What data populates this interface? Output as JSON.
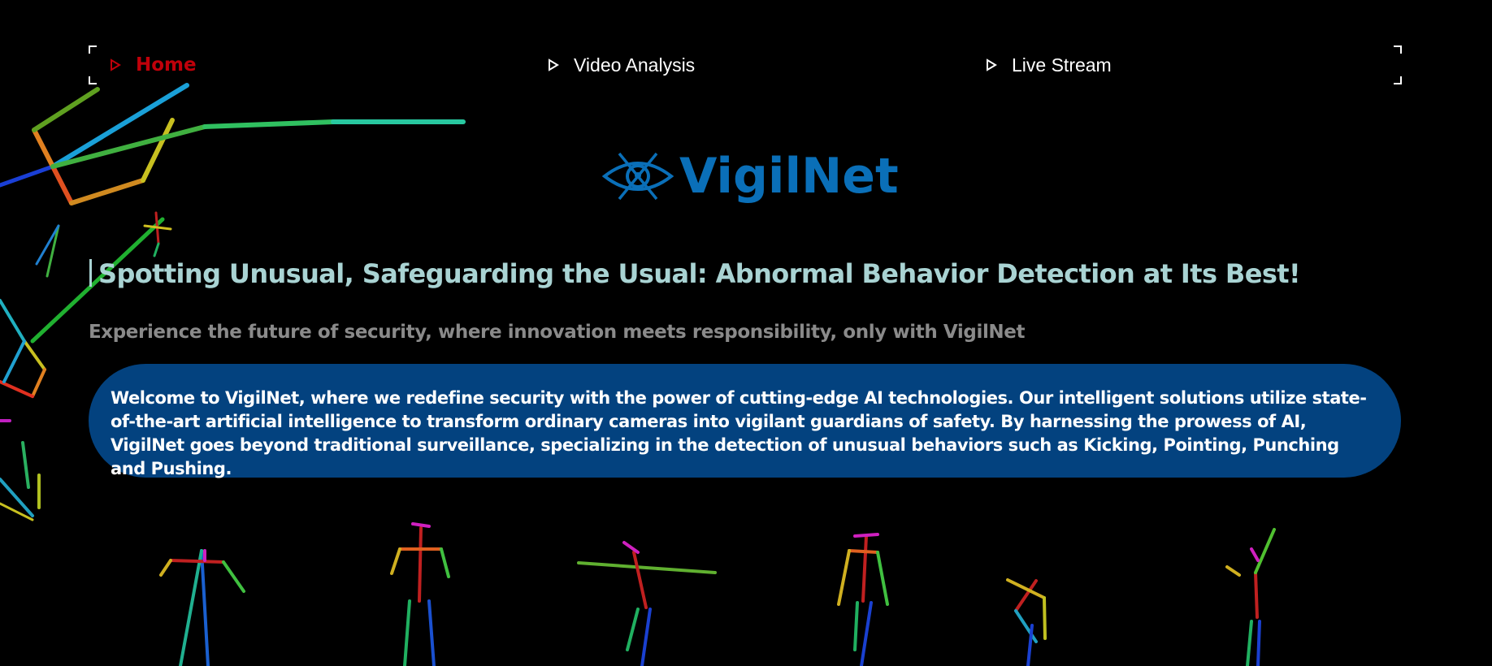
{
  "nav": {
    "items": [
      {
        "label": "Home",
        "active": true,
        "icon": "play-triangle-icon"
      },
      {
        "label": "Video Analysis",
        "active": false,
        "icon": "play-triangle-icon"
      },
      {
        "label": "Live Stream",
        "active": false,
        "icon": "play-triangle-icon"
      }
    ]
  },
  "brand": {
    "name": "VigilNet",
    "icon": "eye-logo-icon",
    "color": "#0a6fb8"
  },
  "hero": {
    "tagline": "Spotting Unusual, Safeguarding the Usual: Abnormal Behavior Detection at Its Best!",
    "subline": "Experience the future of security, where innovation meets responsibility, only with VigilNet",
    "intro": "Welcome to VigilNet, where we redefine security with the power of cutting-edge AI technologies. Our intelligent solutions utilize state-of-the-art artificial intelligence to transform ordinary cameras into vigilant guardians of safety. By harnessing the prowess of AI, VigilNet goes beyond traditional surveillance, specializing in the detection of unusual behaviors such as Kicking, Pointing, Punching and Pushing."
  },
  "colors": {
    "accent": "#c0000a",
    "panel": "#03427f",
    "tagline": "#a9d3d3"
  }
}
